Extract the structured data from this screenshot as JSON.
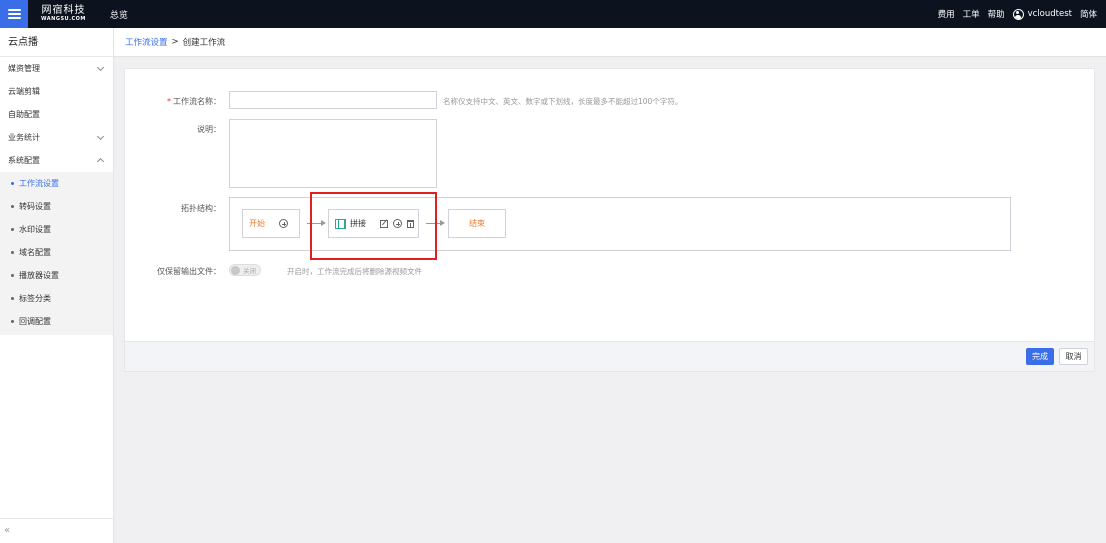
{
  "topbar": {
    "logo_cn": "网宿科技",
    "logo_en": "WANGSU.COM",
    "overview": "总览",
    "links": [
      "费用",
      "工单",
      "帮助"
    ],
    "username": "vcloudtest",
    "language": "简体"
  },
  "sidebar": {
    "title": "云点播",
    "items": [
      {
        "label": "媒资管理"
      },
      {
        "label": "云端剪辑"
      },
      {
        "label": "自助配置"
      },
      {
        "label": "业务统计"
      },
      {
        "label": "系统配置"
      }
    ],
    "subitems": [
      "工作流设置",
      "转码设置",
      "水印设置",
      "域名配置",
      "播放器设置",
      "标签分类",
      "回调配置"
    ],
    "collapse": "«"
  },
  "breadcrumb": {
    "parent": "工作流设置",
    "separator": ">",
    "current": "创建工作流"
  },
  "form": {
    "name_required": "*",
    "name_label": "工作流名称：",
    "name_value": "",
    "name_hint": "名称仅支持中文、英文、数字或下划线，长度最多不能超过100个字符。",
    "desc_label": "说明：",
    "desc_value": "",
    "topo_label": "拓扑结构：",
    "nodes": {
      "start": "开始",
      "middle": "拼接",
      "end": "结束"
    },
    "keep_label": "仅保留输出文件：",
    "keep_toggle": "关闭",
    "keep_hint": "开启时，工作流完成后将删除源视频文件"
  },
  "footer": {
    "confirm": "完成",
    "cancel": "取消"
  },
  "colors": {
    "accent": "#3a6ee8",
    "topbar": "#0d121f",
    "node_text": "#f07a2a",
    "highlight": "#e02020"
  }
}
